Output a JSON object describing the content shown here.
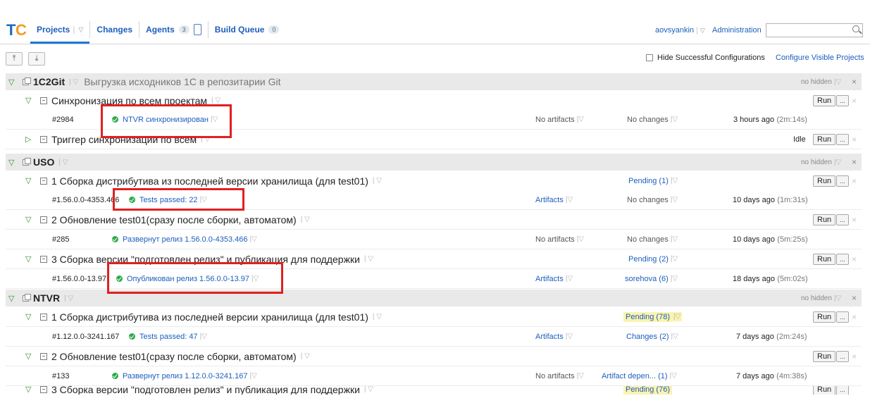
{
  "nav": {
    "projects": "Projects",
    "changes": "Changes",
    "agents": "Agents",
    "agents_count": "3",
    "build_queue": "Build Queue",
    "queue_count": "0"
  },
  "user": {
    "name": "aovsyankin",
    "administration": "Administration",
    "search_value": ""
  },
  "toolbar": {
    "collapse_all": "⤒",
    "expand_all": "⤓",
    "hide_successful": "Hide Successful Configurations",
    "configure_visible": "Configure Visible Projects"
  },
  "common": {
    "no_hidden": "no hidden",
    "run": "Run",
    "more": "...",
    "idle": "Idle",
    "dd": "▽",
    "close": "×",
    "sep": "|"
  },
  "projects": [
    {
      "name": "1C2Git",
      "description": "Выгрузка исходников 1С в репозитарии Git",
      "configs": [
        {
          "name": "Синхронизация по всем проектам",
          "pending": "",
          "build": {
            "number": "#2984",
            "status": "NTVR синхронизирован",
            "artifacts": "No artifacts",
            "changes": "No changes",
            "time": "3 hours ago",
            "duration": "(2m:14s)"
          }
        },
        {
          "name": "Триггер синхронизации по всем",
          "state": "Idle"
        }
      ]
    },
    {
      "name": "USO",
      "description": "",
      "configs": [
        {
          "name": "1 Сборка дистрибутива из последней версии хранилища (для test01)",
          "pending": "Pending (1)",
          "build": {
            "number": "#1.56.0.0-4353.466",
            "status": "Tests passed: 22",
            "artifacts": "Artifacts",
            "changes": "No changes",
            "time": "10 days ago",
            "duration": "(1m:31s)"
          }
        },
        {
          "name": "2 Обновление test01(сразу после сборки, автоматом)",
          "pending": "",
          "build": {
            "number": "#285",
            "status": "Развернут релиз 1.56.0.0-4353.466",
            "artifacts": "No artifacts",
            "changes": "No changes",
            "time": "10 days ago",
            "duration": "(5m:25s)"
          }
        },
        {
          "name": "3 Сборка версии \"подготовлен релиз\" и публикация для поддержки",
          "pending": "Pending (2)",
          "build": {
            "number": "#1.56.0.0-13.97",
            "status": "Опубликован релиз 1.56.0.0-13.97",
            "artifacts": "Artifacts",
            "changes": "sorehova (6)",
            "time": "18 days ago",
            "duration": "(5m:02s)"
          }
        }
      ]
    },
    {
      "name": "NTVR",
      "description": "",
      "configs": [
        {
          "name": "1 Сборка дистрибутива из последней версии хранилища (для test01)",
          "pending": "Pending (78)",
          "build": {
            "number": "#1.12.0.0-3241.167",
            "status": "Tests passed: 47",
            "artifacts": "Artifacts",
            "changes": "Changes (2)",
            "time": "7 days ago",
            "duration": "(2m:24s)"
          }
        },
        {
          "name": "2 Обновление test01(сразу после сборки, автоматом)",
          "pending": "",
          "build": {
            "number": "#133",
            "status": "Развернут релиз 1.12.0.0-3241.167",
            "artifacts": "No artifacts",
            "changes": "Artifact depen... (1)",
            "time": "7 days ago",
            "duration": "(4m:38s)"
          }
        },
        {
          "name": "3 Сборка версии \"подготовлен релиз\" и публикация для поддержки",
          "pending": "Pending (76)"
        }
      ]
    }
  ],
  "colors": {
    "link": "#1c5ebd",
    "success": "#2eaa4a",
    "highlight_box": "#e02020",
    "project_row_bg": "#e9e9e9",
    "pending_highlight": "#fbf3b0"
  }
}
